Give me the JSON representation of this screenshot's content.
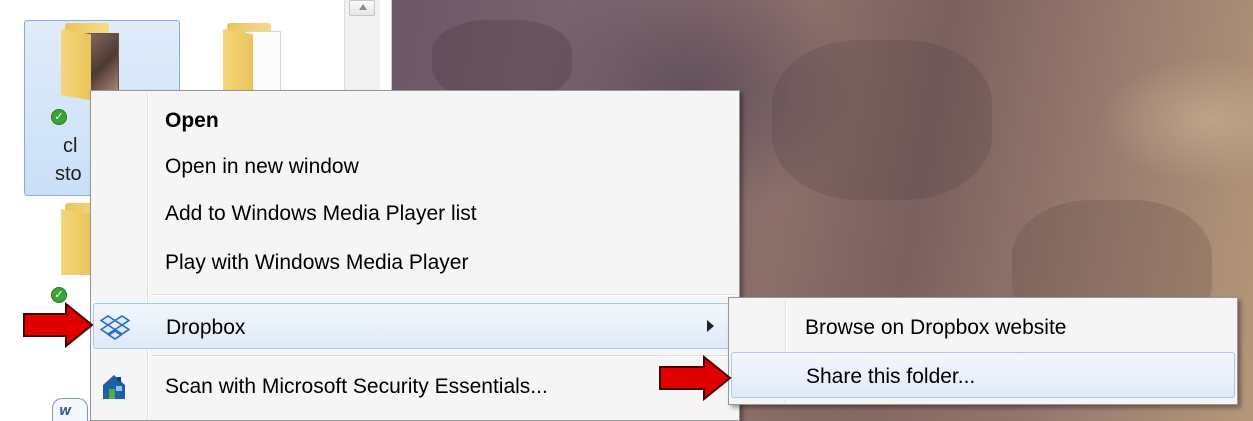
{
  "explorer": {
    "items": [
      {
        "label_line1": "cl",
        "label_line2": "sto",
        "selected": true,
        "synced": true
      },
      {
        "label_line1": "",
        "label_line2": "",
        "selected": false,
        "synced": false
      },
      {
        "label_line1": "",
        "label_line2": "",
        "selected": false,
        "synced": true
      }
    ],
    "partial_badge": "W"
  },
  "context_menu": {
    "items": [
      {
        "label": "Open",
        "bold": true
      },
      {
        "label": "Open in new window"
      },
      {
        "label": "Add to Windows Media Player list"
      },
      {
        "label": "Play with Windows Media Player"
      },
      {
        "label": "Dropbox",
        "icon": "dropbox-icon",
        "has_submenu": true,
        "highlighted": true
      },
      {
        "label": "Scan with Microsoft Security Essentials...",
        "icon": "security-essentials-icon"
      }
    ]
  },
  "submenu": {
    "items": [
      {
        "label": "Browse on Dropbox website"
      },
      {
        "label": "Share this folder...",
        "highlighted": true
      }
    ]
  },
  "colors": {
    "annotation_arrow": "#e00000",
    "highlight_border": "#a8c8ec",
    "selection_fill": "#c9dff7"
  }
}
